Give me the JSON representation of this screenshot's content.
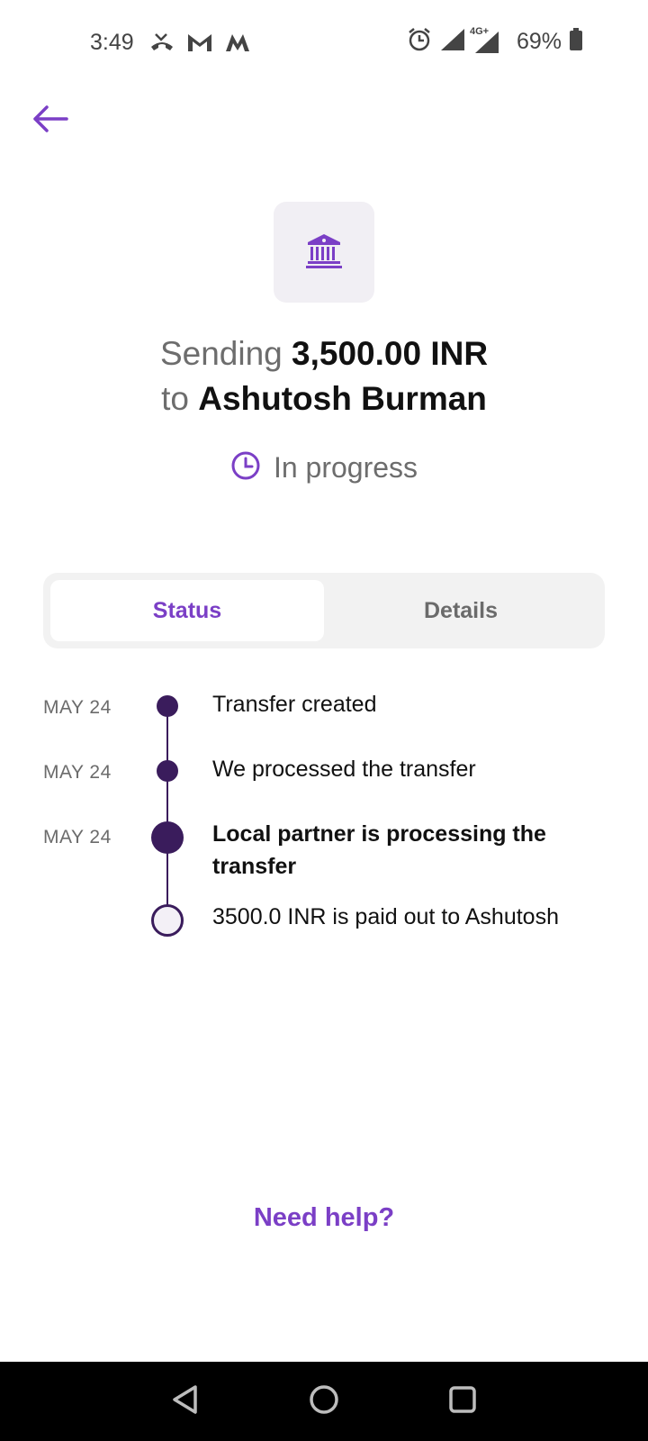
{
  "status_bar": {
    "time": "3:49",
    "left_icons": [
      "missed-call-icon",
      "gmail-icon",
      "myntra-icon"
    ],
    "network": "4G+",
    "battery": "69%"
  },
  "header": {
    "back_icon": "arrow-left-icon"
  },
  "transfer": {
    "icon": "bank-icon",
    "sending_word": "Sending",
    "amount": "3,500.00 INR",
    "to_word": "to",
    "recipient": "Ashutosh Burman",
    "status": "In progress",
    "status_icon": "clock-icon"
  },
  "tabs": [
    {
      "label": "Status",
      "active": true
    },
    {
      "label": "Details",
      "active": false
    }
  ],
  "timeline": [
    {
      "date": "MAY 24",
      "text": "Transfer created",
      "state": "done"
    },
    {
      "date": "MAY 24",
      "text": "We processed the transfer",
      "state": "done"
    },
    {
      "date": "MAY 24",
      "text": "Local partner is processing the transfer",
      "state": "current"
    },
    {
      "date": "",
      "text": "3500.0 INR is paid out to Ashutosh",
      "state": "pending"
    }
  ],
  "help": {
    "label": "Need help?"
  },
  "colors": {
    "accent": "#7b3fc6",
    "timeline": "#3a1c5c",
    "tile_bg": "#f1eff4"
  }
}
